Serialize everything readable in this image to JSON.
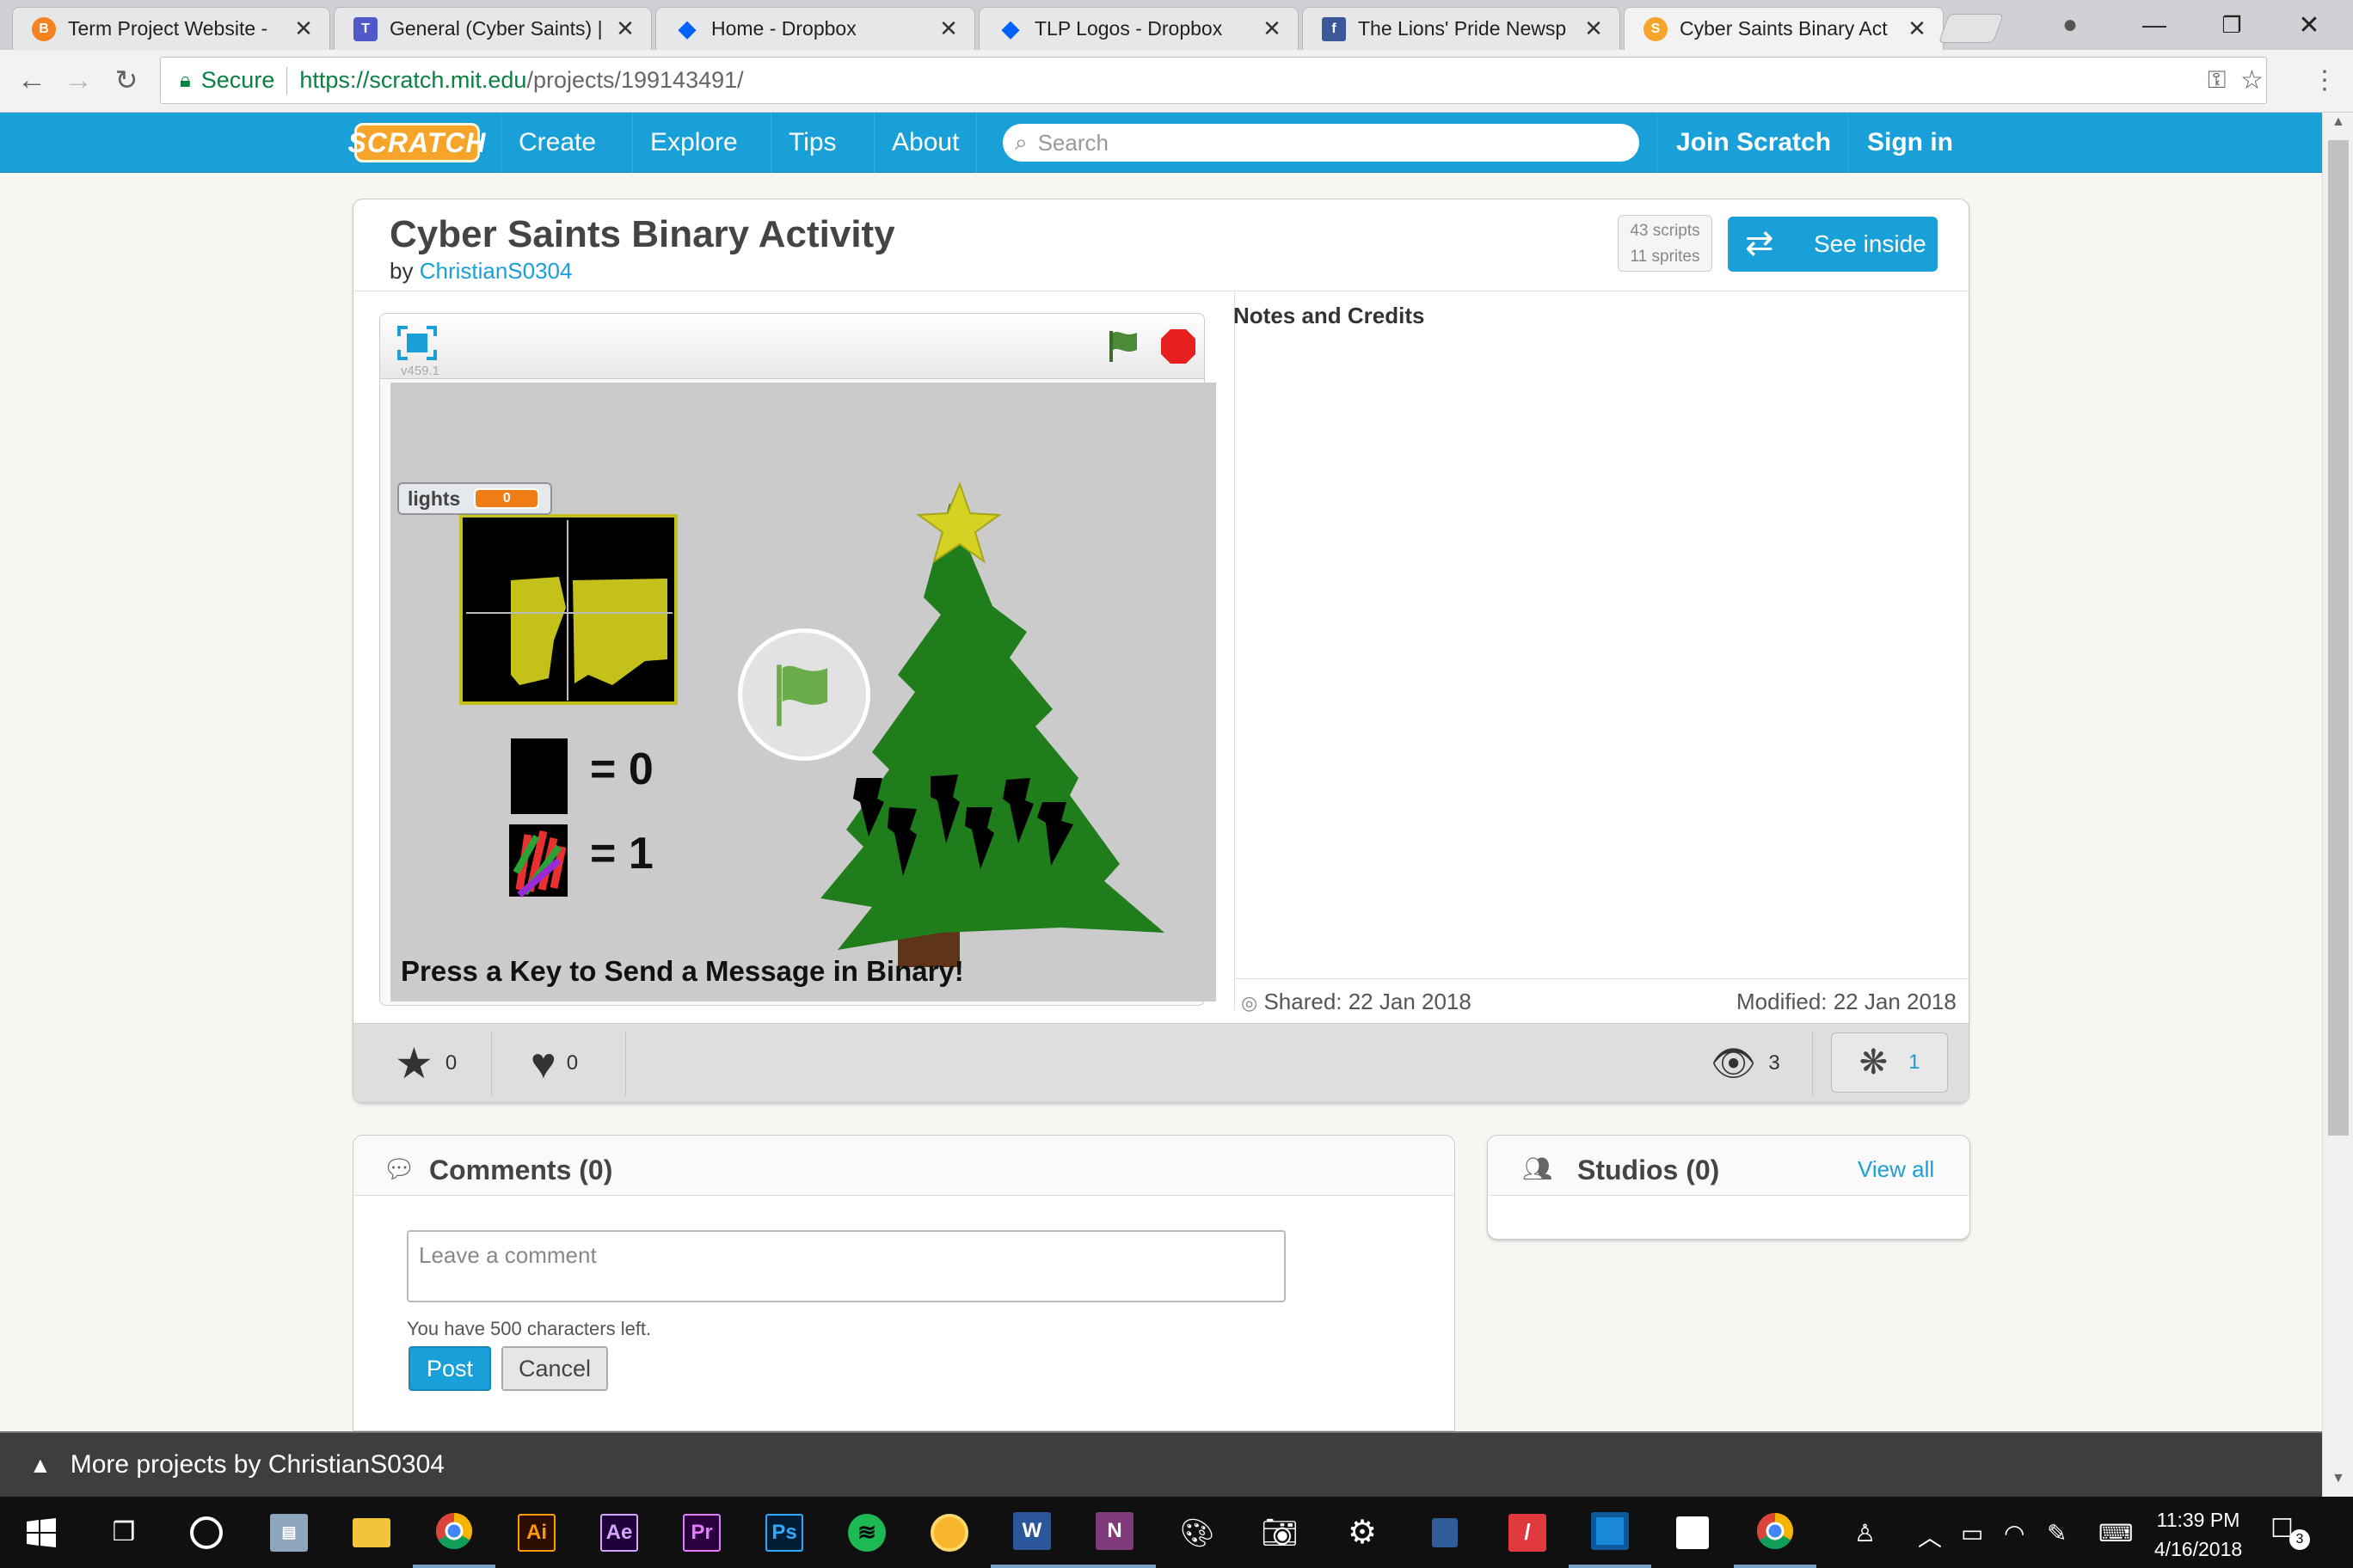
{
  "browser": {
    "tabs": [
      {
        "title": "Term Project Website -",
        "favicon": "blog-icon",
        "color": "#f5821f"
      },
      {
        "title": "General (Cyber Saints) |",
        "favicon": "teams-icon",
        "color": "#5059c9"
      },
      {
        "title": "Home - Dropbox",
        "favicon": "dropbox-icon",
        "color": "#0061fe"
      },
      {
        "title": "TLP Logos - Dropbox",
        "favicon": "dropbox-icon",
        "color": "#0061fe"
      },
      {
        "title": "The Lions' Pride Newsp",
        "favicon": "facebook-icon",
        "color": "#3b5998"
      },
      {
        "title": "Cyber Saints Binary Act",
        "favicon": "scratch-icon",
        "color": "#f6a52a"
      }
    ],
    "secure_label": "Secure",
    "url_scheme_host": "https://scratch.mit.edu",
    "url_path": "/projects/199143491/"
  },
  "scratch_nav": {
    "logo": "SCRATCH",
    "items": [
      "Create",
      "Explore",
      "Tips",
      "About"
    ],
    "search_placeholder": "Search",
    "join": "Join Scratch",
    "signin": "Sign in"
  },
  "project": {
    "title": "Cyber Saints Binary Activity",
    "by_prefix": "by",
    "author": "ChristianS0304",
    "scripts": "43 scripts",
    "sprites": "11 sprites",
    "see_inside": "See inside",
    "version": "v459.1",
    "notes_heading": "Notes and Credits",
    "shared": "Shared: 22 Jan 2018",
    "modified": "Modified: 22 Jan 2018",
    "loves": "0",
    "favorites": "0",
    "views": "3",
    "remixes": "1"
  },
  "stage": {
    "monitor_label": "lights",
    "monitor_value": "0",
    "eq_zero": "= 0",
    "eq_one": "= 1",
    "caption": "Press a Key to Send a Message in Binary!"
  },
  "comments": {
    "title": "Comments (0)",
    "placeholder": "Leave a comment",
    "chars_left": "You have 500 characters left.",
    "post": "Post",
    "cancel": "Cancel"
  },
  "studios": {
    "title": "Studios (0)",
    "view_all": "View all"
  },
  "more_projects": "More projects by ChristianS0304",
  "taskbar": {
    "time": "11:39 PM",
    "date": "4/16/2018",
    "notifications": "3",
    "apps": [
      {
        "name": "task-view-icon",
        "label": "",
        "bg": "",
        "fg": "#fff"
      },
      {
        "name": "cortana-icon",
        "label": "",
        "bg": "",
        "fg": "#fff"
      },
      {
        "name": "file-manager-icon",
        "label": "",
        "bg": "",
        "fg": "#fff"
      },
      {
        "name": "explorer-icon",
        "label": "",
        "bg": "#f3c33c",
        "fg": "#fff"
      },
      {
        "name": "chrome-icon",
        "label": "",
        "bg": "",
        "fg": "#fff"
      },
      {
        "name": "illustrator-icon",
        "label": "Ai",
        "bg": "#2b0e00",
        "fg": "#ff9a00"
      },
      {
        "name": "after-effects-icon",
        "label": "Ae",
        "bg": "#1d0038",
        "fg": "#d8a2ff"
      },
      {
        "name": "premiere-icon",
        "label": "Pr",
        "bg": "#2a003f",
        "fg": "#e47aff"
      },
      {
        "name": "photoshop-icon",
        "label": "Ps",
        "bg": "#001d34",
        "fg": "#31a8ff"
      },
      {
        "name": "spotify-icon",
        "label": "",
        "bg": "#1db954",
        "fg": "#000"
      },
      {
        "name": "yellow-app-icon",
        "label": "",
        "bg": "#f7b52c",
        "fg": "#fff"
      },
      {
        "name": "word-icon",
        "label": "W",
        "bg": "#2b579a",
        "fg": "#fff"
      },
      {
        "name": "onenote-icon",
        "label": "N",
        "bg": "#80397b",
        "fg": "#fff"
      },
      {
        "name": "paint-icon",
        "label": "",
        "bg": "",
        "fg": "#fff"
      },
      {
        "name": "camera-icon",
        "label": "",
        "bg": "",
        "fg": "#fff"
      },
      {
        "name": "settings-icon",
        "label": "",
        "bg": "",
        "fg": "#fff"
      },
      {
        "name": "network-app-icon",
        "label": "",
        "bg": "",
        "fg": "#fff"
      },
      {
        "name": "pen-app-icon",
        "label": "",
        "bg": "#e03a3e",
        "fg": "#fff"
      },
      {
        "name": "frame-app-icon",
        "label": "",
        "bg": "#1a88d8",
        "fg": "#fff"
      },
      {
        "name": "sticky-notes-icon",
        "label": "",
        "bg": "#fff",
        "fg": "#000"
      },
      {
        "name": "chrome-icon-2",
        "label": "",
        "bg": "",
        "fg": "#fff"
      }
    ]
  }
}
